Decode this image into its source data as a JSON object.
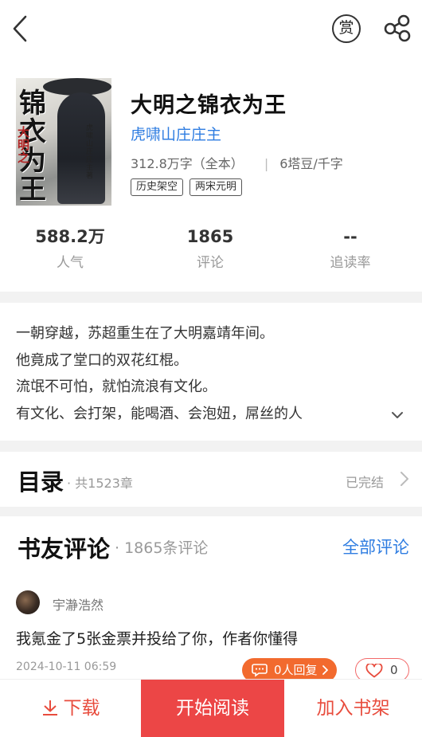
{
  "topbar": {
    "reward_label": "赏"
  },
  "book": {
    "cover": {
      "title_art": "锦衣为王",
      "title_prefix": "大明之",
      "author_art": "虎啸山庄庄主著"
    },
    "title": "大明之锦衣为王",
    "author": "虎啸山庄庄主",
    "word_count": "312.8万字（全本）",
    "price": "6塔豆/千字",
    "tags": [
      "历史架空",
      "两宋元明"
    ]
  },
  "stats": [
    {
      "value": "588.2万",
      "label": "人气"
    },
    {
      "value": "1865",
      "label": "评论"
    },
    {
      "value": "--",
      "label": "追读率"
    }
  ],
  "intro": {
    "lines": [
      "一朝穿越，苏超重生在了大明嘉靖年间。",
      "他竟成了堂口的双花红棍。",
      "流氓不可怕，就怕流浪有文化。",
      "有文化、会打架，能喝酒、会泡妞，屌丝的人"
    ]
  },
  "catalog": {
    "title": "目录",
    "count": "· 共1523章",
    "status": "已完结"
  },
  "reviews": {
    "title": "书友评论",
    "count": "· 1865条评论",
    "all_label": "全部评论",
    "items": [
      {
        "user": "宇瀞浩然",
        "text": "我氪金了5张金票并投给了你，作者你懂得",
        "time": "2024-10-11 06:59",
        "reply_label": "0人回复",
        "likes": "0"
      }
    ]
  },
  "bottombar": {
    "download_label": "下载",
    "read_label": "开始阅读",
    "shelf_label": "加入书架"
  },
  "colors": {
    "accent_red": "#ec4646",
    "link_blue": "#2f7de1",
    "reply_orange": "#f26a2e"
  }
}
